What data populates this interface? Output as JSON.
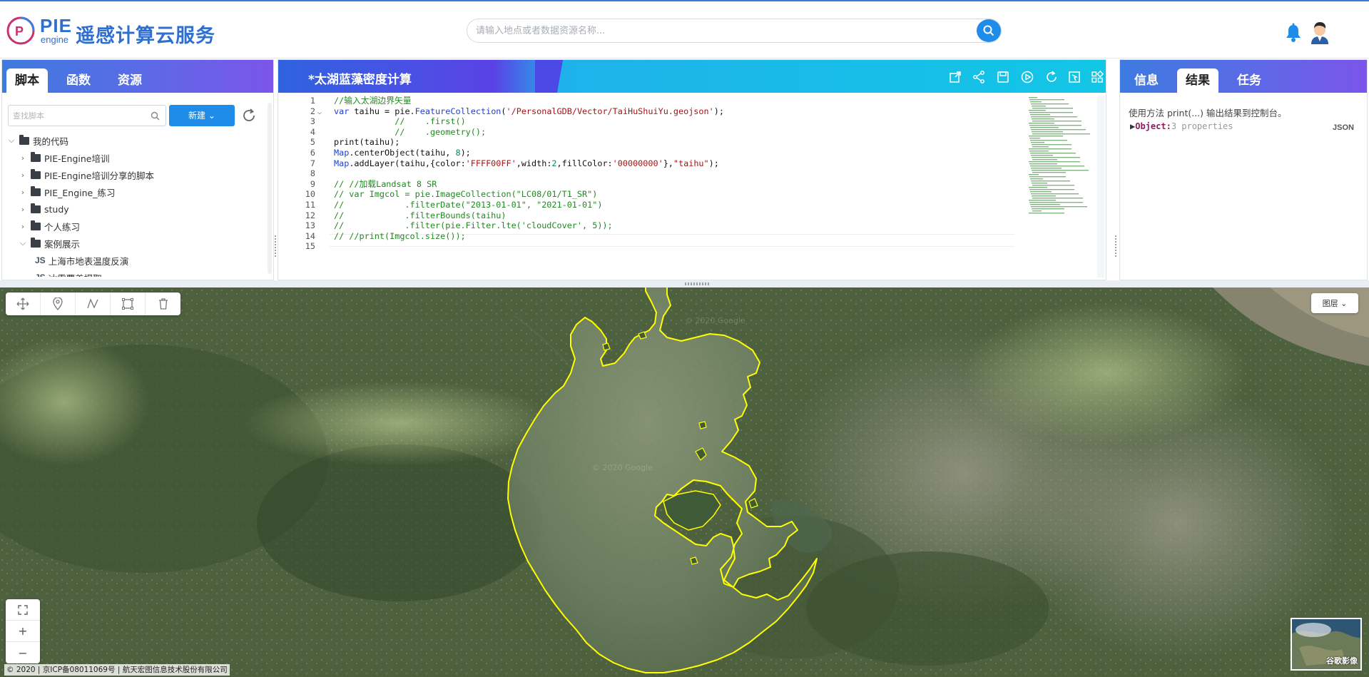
{
  "header": {
    "logo_pie": "PIE",
    "logo_engine": "engine",
    "title": "遥感计算云服务",
    "search_placeholder": "请输入地点或者数据资源名称..."
  },
  "left_panel": {
    "tabs": [
      {
        "label": "脚本",
        "active": true
      },
      {
        "label": "函数",
        "active": false
      },
      {
        "label": "资源",
        "active": false
      }
    ],
    "search_placeholder": "查找脚本",
    "new_button_label": "新建",
    "tree": [
      {
        "label": "我的代码",
        "type": "folder",
        "expanded": true,
        "level": 0
      },
      {
        "label": "PIE-Engine培训",
        "type": "folder",
        "expanded": false,
        "level": 1
      },
      {
        "label": "PIE-Engine培训分享的脚本",
        "type": "folder",
        "expanded": false,
        "level": 1
      },
      {
        "label": "PIE_Engine_练习",
        "type": "folder",
        "expanded": false,
        "level": 1
      },
      {
        "label": "study",
        "type": "folder",
        "expanded": false,
        "level": 1
      },
      {
        "label": "个人练习",
        "type": "folder",
        "expanded": false,
        "level": 1
      },
      {
        "label": "案例展示",
        "type": "folder",
        "expanded": true,
        "level": 1
      },
      {
        "label": "上海市地表温度反演",
        "type": "script",
        "badge": "JS",
        "level": 2
      },
      {
        "label": "冰雪覆盖提取",
        "type": "script",
        "badge": "JS",
        "level": 2
      }
    ]
  },
  "editor": {
    "title": "*太湖蓝藻密度计算",
    "lines": [
      {
        "n": "1",
        "html": "<span class='c-comment'>//输入太湖边界矢量</span>"
      },
      {
        "n": "2",
        "html": "<span class='c-keyword'>var</span> taihu = pie.<span class='c-keyword'>FeatureCollection</span>(<span class='c-string'>'/PersonalGDB/Vector/TaiHuShuiYu.geojson'</span>);"
      },
      {
        "n": "3",
        "html": "            <span class='c-comment'>//    .first()</span>"
      },
      {
        "n": "4",
        "html": "            <span class='c-comment'>//    .geometry();</span>"
      },
      {
        "n": "5",
        "html": "print(taihu);"
      },
      {
        "n": "6",
        "html": "<span class='c-keyword'>Map</span>.centerObject(taihu, <span class='c-num'>8</span>);"
      },
      {
        "n": "7",
        "html": "<span class='c-keyword'>Map</span>.addLayer(taihu,{color:<span class='c-string'>'FFFF00FF'</span>,width:<span class='c-num'>2</span>,fillColor:<span class='c-string'>'00000000'</span>},<span class='c-string'>\"taihu\"</span>);"
      },
      {
        "n": "8",
        "html": ""
      },
      {
        "n": "9",
        "html": "<span class='c-comment'>// //加载Landsat 8 SR</span>"
      },
      {
        "n": "10",
        "html": "<span class='c-comment'>// var Imgcol = pie.ImageCollection(\"LC08/01/T1_SR\")</span>"
      },
      {
        "n": "11",
        "html": "<span class='c-comment'>//            .filterDate(\"2013-01-01\", \"2021-01-01\")</span>"
      },
      {
        "n": "12",
        "html": "<span class='c-comment'>//            .filterBounds(taihu)</span>"
      },
      {
        "n": "13",
        "html": "<span class='c-comment'>//            .filter(pie.Filter.lte('cloudCover', 5));</span>"
      },
      {
        "n": "14",
        "html": "<span class='c-comment'>// //print(Imgcol.size());</span>"
      },
      {
        "n": "15",
        "html": ""
      }
    ]
  },
  "right_panel": {
    "tabs": [
      {
        "label": "信息",
        "active": false
      },
      {
        "label": "结果",
        "active": true
      },
      {
        "label": "任务",
        "active": false
      }
    ],
    "hint": "使用方法 print(...) 输出结果到控制台。",
    "object_key": "Object:",
    "object_props": "3 properties",
    "json_label": "JSON"
  },
  "map": {
    "layer_button": "图层",
    "copyright": "© 2020 | 京ICP备08011069号 | 航天宏图信息技术股份有限公司",
    "basemap_label": "谷歌影像",
    "zoom_in": "+",
    "zoom_out": "−",
    "watermark": "© 2020 Google"
  },
  "colors": {
    "accent": "#1e8ce8",
    "lake_outline": "#ffff00"
  }
}
